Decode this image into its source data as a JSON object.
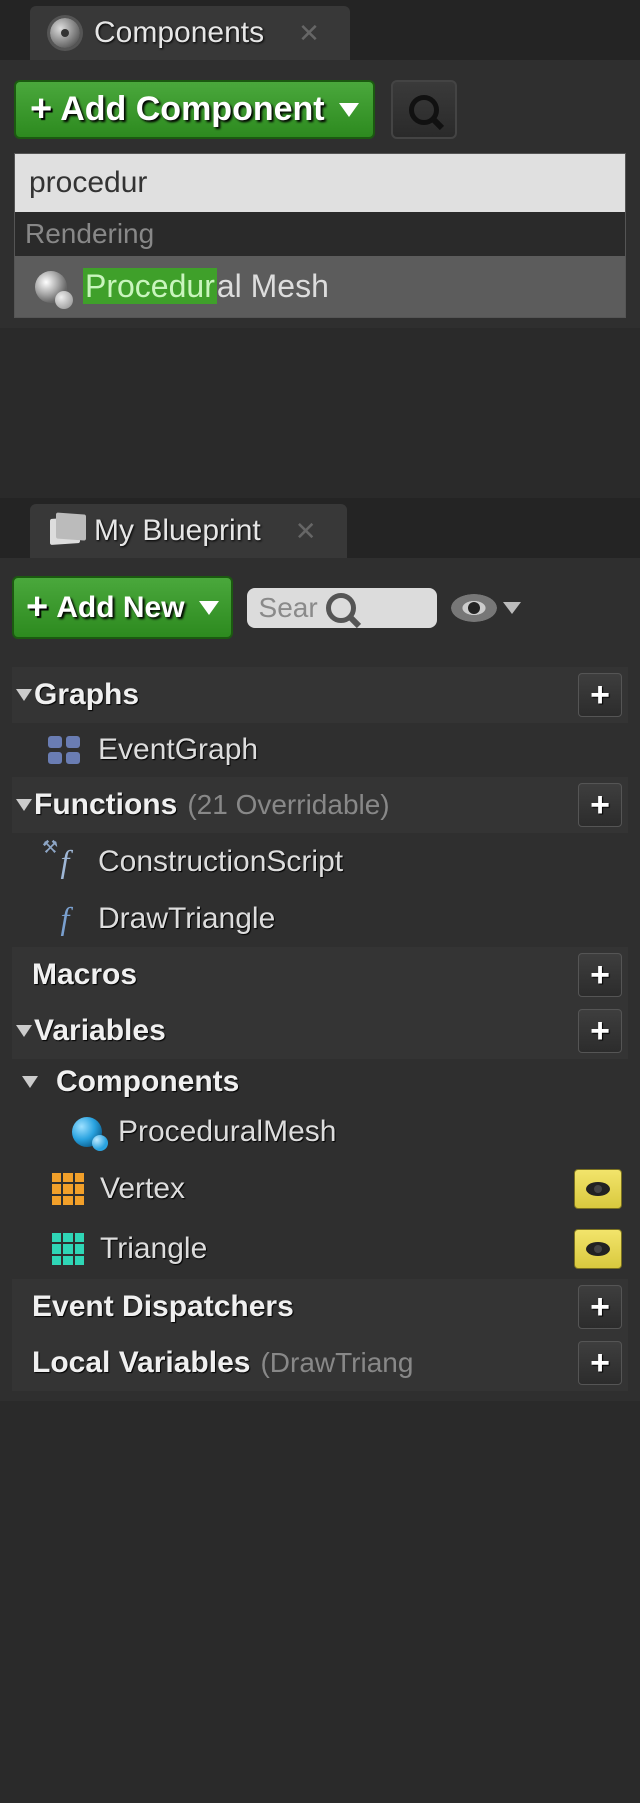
{
  "components_panel": {
    "tab_title": "Components",
    "add_button_label": "Add Component",
    "search_value": "procedur",
    "results": {
      "group_label": "Rendering",
      "item_highlight": "Procedur",
      "item_rest": "al Mesh"
    }
  },
  "blueprint_panel": {
    "tab_title": "My Blueprint",
    "add_button_label": "Add New",
    "search_placeholder": "Sear",
    "sections": {
      "graphs": {
        "title": "Graphs",
        "items": [
          "EventGraph"
        ]
      },
      "functions": {
        "title": "Functions",
        "hint": "(21 Overridable)",
        "items": [
          "ConstructionScript",
          "DrawTriangle"
        ]
      },
      "macros": {
        "title": "Macros"
      },
      "variables": {
        "title": "Variables"
      },
      "components": {
        "title": "Components",
        "items": [
          "ProceduralMesh",
          "Vertex",
          "Triangle"
        ]
      },
      "event_dispatchers": {
        "title": "Event Dispatchers"
      },
      "local_variables": {
        "title": "Local Variables",
        "hint": "(DrawTriang"
      }
    }
  }
}
